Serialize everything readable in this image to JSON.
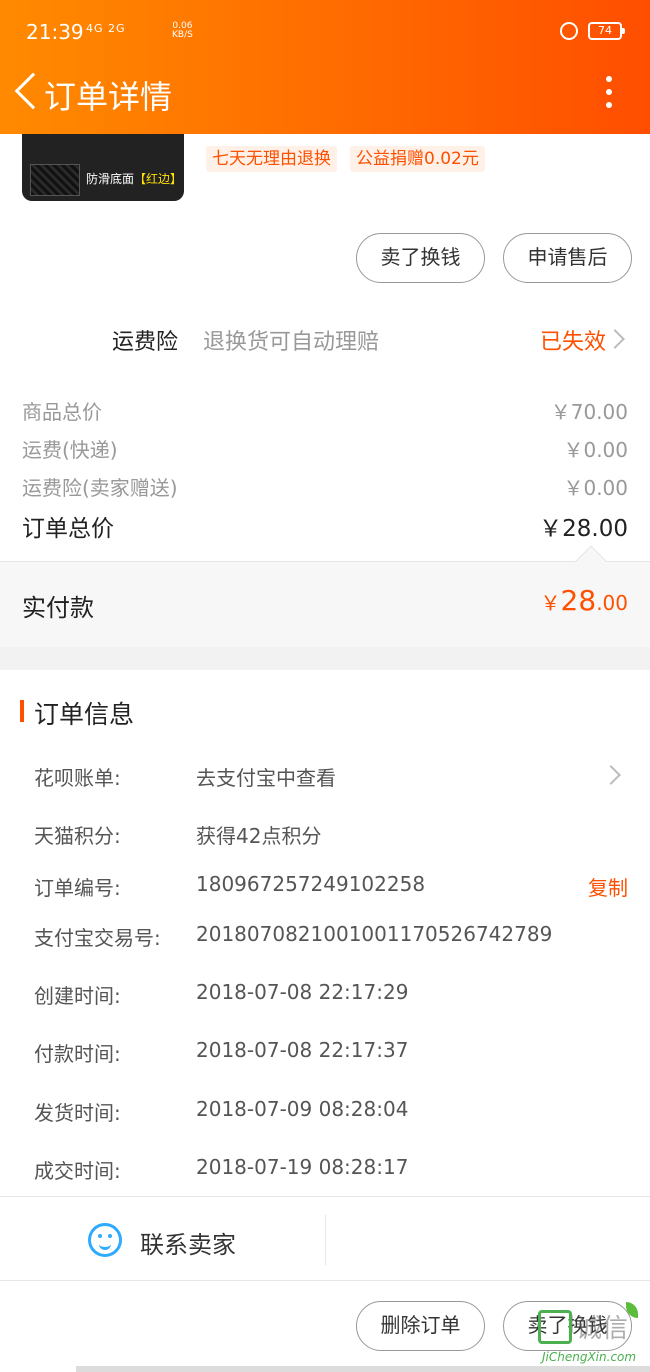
{
  "status_bar": {
    "time": "21:39",
    "signal_text": "4G 2G",
    "net_speed": "0.06",
    "net_unit": "KB/S",
    "battery": "74"
  },
  "header": {
    "title": "订单详情"
  },
  "product": {
    "thumb_caption": "防滑底面",
    "thumb_caption_highlight": "【红边】",
    "tags": [
      "七天无理由退换",
      "公益捐赠0.02元"
    ],
    "buttons": [
      "卖了换钱",
      "申请售后"
    ]
  },
  "insurance": {
    "label": "运费险",
    "description": "退换货可自动理赔",
    "status": "已失效"
  },
  "prices": {
    "rows": [
      {
        "label": "商品总价",
        "value": "￥70.00"
      },
      {
        "label": "运费(快递)",
        "value": "￥0.00"
      },
      {
        "label": "运费险(卖家赠送)",
        "value": "￥0.00"
      }
    ],
    "total_label": "订单总价",
    "total_value": "￥28.00",
    "paid_label": "实付款",
    "paid_yen": "￥",
    "paid_int": "28",
    "paid_dec": ".00"
  },
  "order_info": {
    "title": "订单信息",
    "rows": [
      {
        "key": "花呗账单:",
        "value": "去支付宝中查看"
      },
      {
        "key": "天猫积分:",
        "value": "获得42点积分"
      },
      {
        "key": "订单编号:",
        "value": "180967257249102258",
        "action": "复制"
      },
      {
        "key": "支付宝交易号:",
        "value": "2018070821001001170526742789"
      },
      {
        "key": "创建时间:",
        "value": "2018-07-08 22:17:29"
      },
      {
        "key": "付款时间:",
        "value": "2018-07-08 22:17:37"
      },
      {
        "key": "发货时间:",
        "value": "2018-07-09 08:28:04"
      },
      {
        "key": "成交时间:",
        "value": "2018-07-19 08:28:17"
      }
    ]
  },
  "contact": {
    "label": "联系卖家"
  },
  "footer": {
    "buttons": [
      "删除订单",
      "卖了换钱"
    ]
  },
  "watermark": {
    "text": "诚信",
    "url": "JiChengXin.com"
  },
  "colors": {
    "accent": "#ff5000",
    "header_start": "#ff8a00",
    "header_end": "#ff4e00",
    "contact_icon": "#2eaaff"
  }
}
